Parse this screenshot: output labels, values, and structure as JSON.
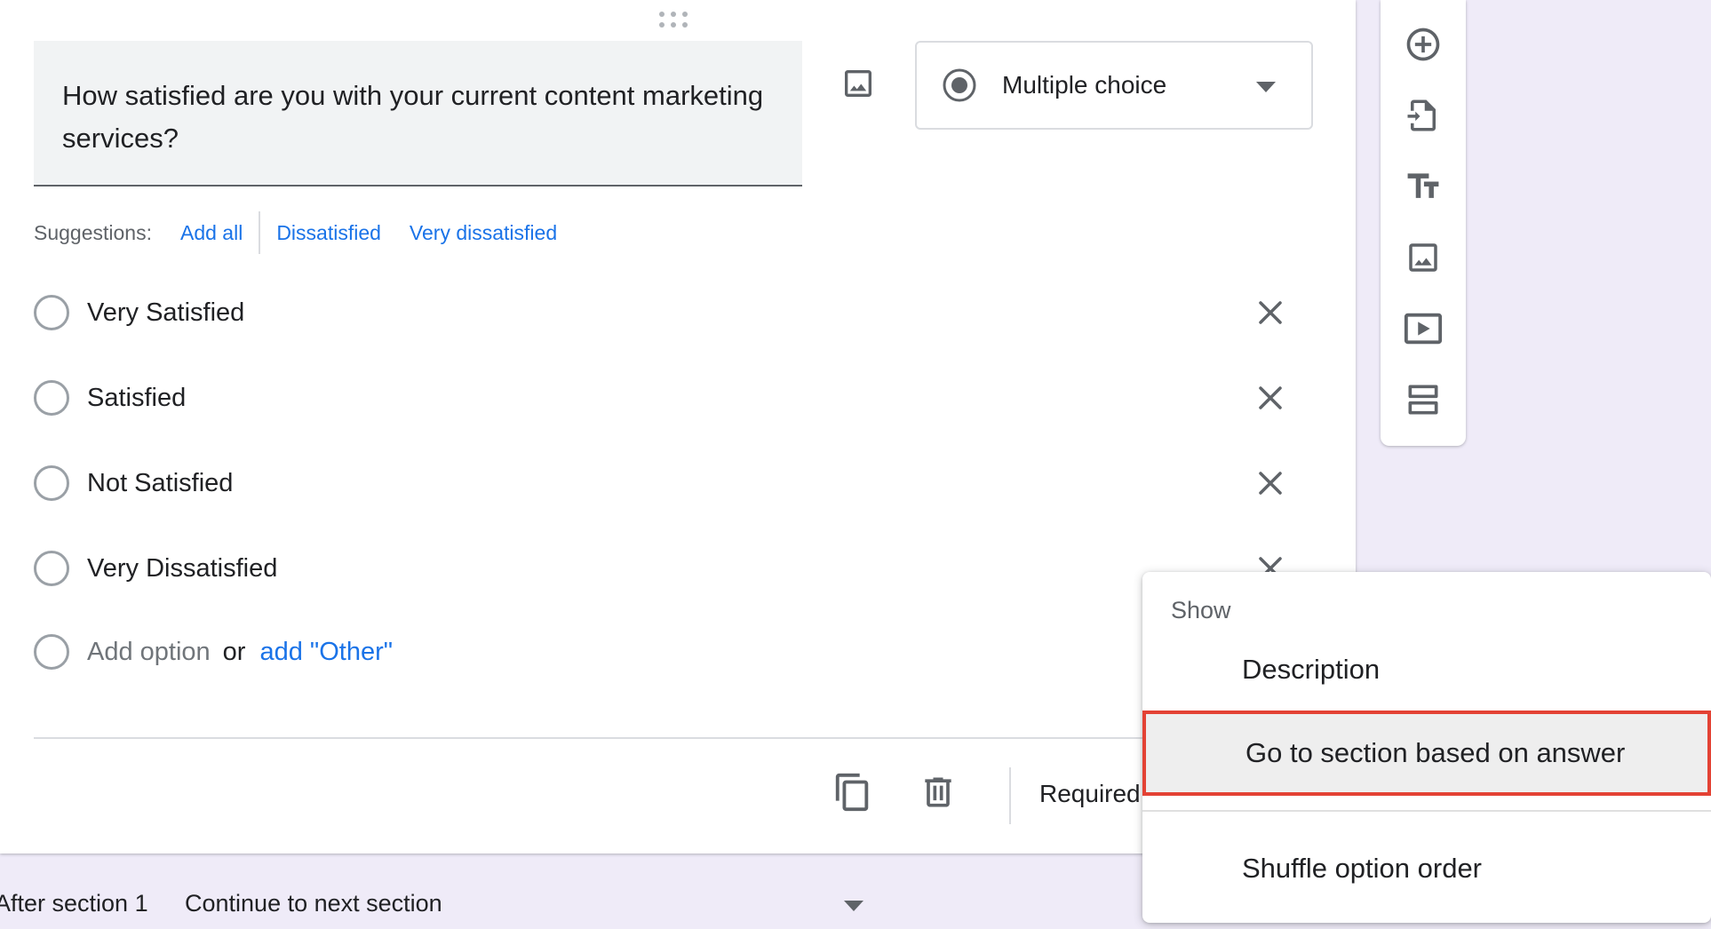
{
  "question": {
    "text": "How satisfied are you with your current content marketing services?",
    "type_label": "Multiple choice"
  },
  "suggestions": {
    "label": "Suggestions:",
    "items": [
      "Add all",
      "Dissatisfied",
      "Very dissatisfied"
    ]
  },
  "options": [
    "Very Satisfied",
    "Satisfied",
    "Not Satisfied",
    "Very Dissatisfied"
  ],
  "add_option": {
    "label": "Add option",
    "or": "or",
    "other": "add \"Other\""
  },
  "footer": {
    "required_label": "Required"
  },
  "section_nav": {
    "after": "After section 1",
    "action": "Continue to next section"
  },
  "menu": {
    "heading": "Show",
    "items": [
      "Description",
      "Go to section based on answer",
      "Shuffle option order"
    ]
  },
  "colors": {
    "accent": "#1a73e8",
    "highlight_border": "#e34234",
    "background": "#efebf8"
  }
}
